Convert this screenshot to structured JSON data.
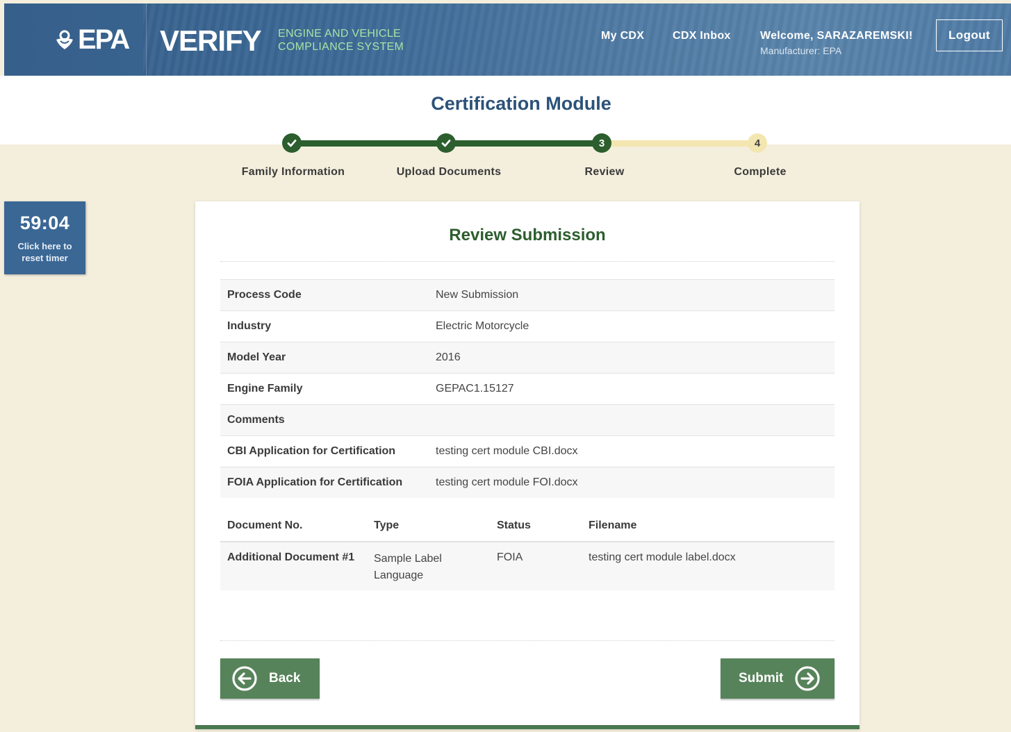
{
  "header": {
    "epa_logo": "EPA",
    "app_name": "VERIFY",
    "app_subtitle_line1": "ENGINE AND VEHICLE",
    "app_subtitle_line2": "COMPLIANCE SYSTEM",
    "nav": {
      "my_cdx": "My CDX",
      "cdx_inbox": "CDX Inbox"
    },
    "welcome": "Welcome, SARAZAREMSKI!",
    "manufacturer": "Manufacturer: EPA",
    "logout": "Logout"
  },
  "module_title": "Certification Module",
  "stepper": {
    "steps": [
      {
        "number": "1",
        "label": "Family Information",
        "state": "complete"
      },
      {
        "number": "2",
        "label": "Upload Documents",
        "state": "complete"
      },
      {
        "number": "3",
        "label": "Review",
        "state": "current"
      },
      {
        "number": "4",
        "label": "Complete",
        "state": "todo"
      }
    ]
  },
  "timer": {
    "time": "59:04",
    "text_line1": "Click here to",
    "text_line2": "reset timer"
  },
  "review": {
    "title": "Review Submission",
    "fields": [
      {
        "label": "Process Code",
        "value": "New Submission"
      },
      {
        "label": "Industry",
        "value": "Electric Motorcycle"
      },
      {
        "label": "Model Year",
        "value": "2016"
      },
      {
        "label": "Engine Family",
        "value": "GEPAC1.15127"
      },
      {
        "label": "Comments",
        "value": ""
      },
      {
        "label": "CBI Application for Certification",
        "value": "testing cert module CBI.docx"
      },
      {
        "label": "FOIA Application for Certification",
        "value": "testing cert module FOI.docx"
      }
    ],
    "documents": {
      "columns": [
        "Document No.",
        "Type",
        "Status",
        "Filename"
      ],
      "rows": [
        {
          "doc_no": "Additional Document #1",
          "type_line1": "Sample Label",
          "type_line2": "Language",
          "status": "FOIA",
          "filename": "testing cert module label.docx"
        }
      ]
    },
    "buttons": {
      "back": "Back",
      "submit": "Submit"
    }
  },
  "colors": {
    "header_blue": "#3d6a97",
    "accent_green": "#2c5e2e",
    "button_green": "#57835a",
    "stepper_todo": "#f3e6b0",
    "page_bg": "#f4efdd",
    "title_blue": "#2b5279"
  },
  "icons": [
    "epa-flower-icon",
    "check-icon",
    "arrow-left-circle-icon",
    "arrow-right-circle-icon"
  ]
}
